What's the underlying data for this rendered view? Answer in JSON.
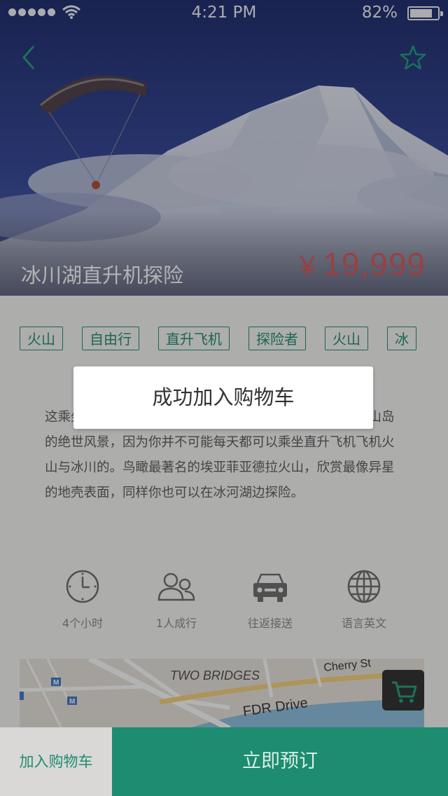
{
  "status_bar": {
    "time": "4:21 PM",
    "battery": "82%"
  },
  "hero": {
    "title": "冰川湖直升机探险",
    "currency": "¥",
    "price": "19,999"
  },
  "tags": [
    "火山",
    "自由行",
    "直升飞机",
    "探险者",
    "火山",
    "冰"
  ],
  "description": "这乘坐直升飞机从火山到冰川，从高空俯瞰欧洲最美丽火山岛的绝世风景，因为你并不可能每天都可以乘坐直升飞机飞机火山与冰川的。鸟瞰最著名的埃亚菲亚德拉火山，欣赏最像异星的地壳表面，同样你也可以在冰河湖边探险。",
  "features": [
    {
      "icon": "clock-icon",
      "label": "4个小时"
    },
    {
      "icon": "people-icon",
      "label": "1人成行"
    },
    {
      "icon": "car-icon",
      "label": "往返接送"
    },
    {
      "icon": "globe-icon",
      "label": "语言英文"
    }
  ],
  "map": {
    "labels": [
      "TWO BRIDGES",
      "FDR Drive",
      "Cherry St"
    ],
    "metro_badge": "M"
  },
  "bottom_bar": {
    "add_to_cart": "加入购物车",
    "book_now": "立即预订"
  },
  "toast": {
    "message": "成功加入购物车"
  },
  "colors": {
    "accent": "#1d8c6f",
    "price": "#d8585c",
    "hero_bg": "#2b3a7a"
  }
}
